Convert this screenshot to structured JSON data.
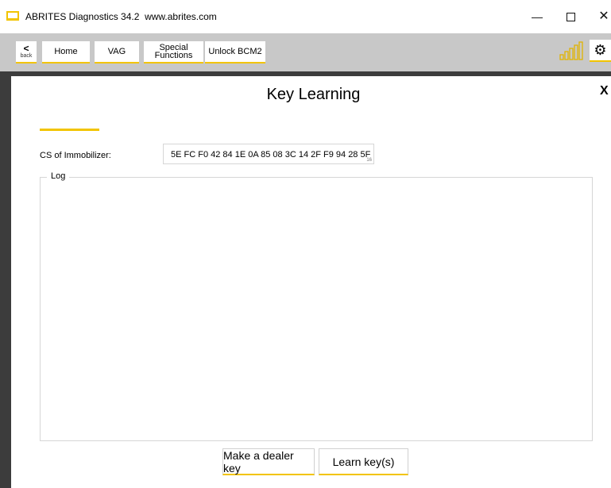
{
  "window": {
    "title": "ABRITES Diagnostics 34.2",
    "url": "www.abrites.com",
    "minimize": "—",
    "close": "✕"
  },
  "toolbar": {
    "back_arrow": "<",
    "back_label": "back",
    "home": "Home",
    "vag": "VAG",
    "special_line1": "Special",
    "special_line2": "Functions",
    "unlock": "Unlock BCM2",
    "settings_glyph": "⚙"
  },
  "page": {
    "title": "Key Learning",
    "close": "X"
  },
  "form": {
    "cs_label": "CS of Immobilizer:",
    "cs_value": "5E FC F0 42 84 1E 0A 85 08 3C 14 2F F9 94 28 5F",
    "cs_count": "16"
  },
  "log": {
    "label": "Log"
  },
  "actions": {
    "dealer_key": "Make a dealer key",
    "learn_keys": "Learn key(s)"
  },
  "colors": {
    "accent": "#f2c400",
    "toolbar_bg": "#c8c8c8",
    "frame": "#3c3c3c"
  },
  "icons": {
    "signal": "signal-strength-icon",
    "settings": "gear-icon"
  }
}
